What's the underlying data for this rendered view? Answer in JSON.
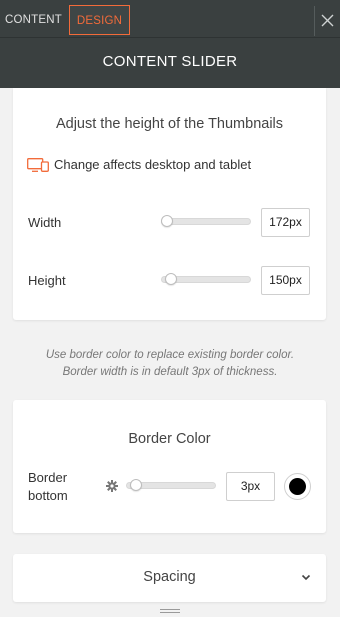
{
  "tabs": [
    {
      "label": "CONTENT",
      "active": false
    },
    {
      "label": "DESIGN",
      "active": true
    }
  ],
  "header": {
    "title": "CONTENT SLIDER"
  },
  "thumbnails": {
    "title": "Adjust the height of the Thumbnails",
    "device_note": "Change affects desktop and tablet",
    "width": {
      "label": "Width",
      "value": "172px",
      "level": 0.0
    },
    "height": {
      "label": "Height",
      "value": "150px",
      "level": 0.05
    }
  },
  "note": {
    "line1": "Use border color to replace existing border color.",
    "line2": "Border width is in default 3px of thickness."
  },
  "border": {
    "title": "Border Color",
    "label_line1": "Border",
    "label_line2": "bottom",
    "value": "3px",
    "level": 0.05,
    "color": "#000000"
  },
  "spacing": {
    "title": "Spacing"
  },
  "colors": {
    "accent": "#f26b3a",
    "header_bg": "#3a4040"
  },
  "icons": {
    "close": "close-icon",
    "device": "desktop-tablet-icon",
    "gear": "gear-icon",
    "chevron": "chevron-down-icon",
    "grip": "drag-handle-icon"
  }
}
